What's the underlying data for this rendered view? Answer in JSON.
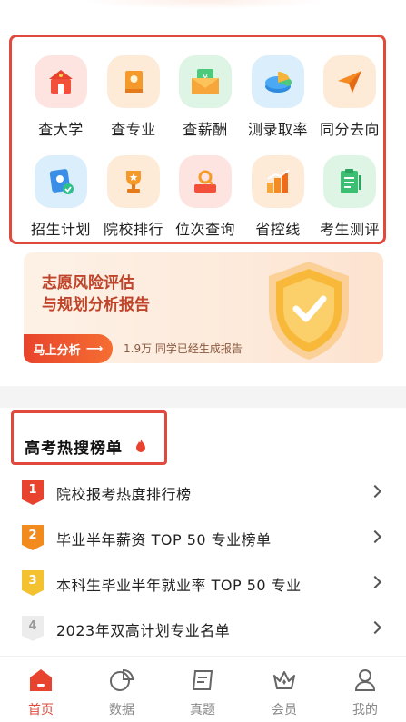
{
  "quick_grid": [
    {
      "label": "查大学",
      "icon": "university-icon"
    },
    {
      "label": "查专业",
      "icon": "book-icon"
    },
    {
      "label": "查薪酬",
      "icon": "salary-envelope-icon"
    },
    {
      "label": "测录取率",
      "icon": "pie-chart-icon"
    },
    {
      "label": "同分去向",
      "icon": "paper-plane-icon"
    },
    {
      "label": "招生计划",
      "icon": "enroll-plan-icon"
    },
    {
      "label": "院校排行",
      "icon": "trophy-icon"
    },
    {
      "label": "位次查询",
      "icon": "rank-search-icon"
    },
    {
      "label": "省控线",
      "icon": "bar-growth-icon"
    },
    {
      "label": "考生测评",
      "icon": "clipboard-icon"
    }
  ],
  "banner": {
    "title": "志愿风险评估\n与规划分析报告",
    "button": "马上分析",
    "note": "1.9万 同学已经生成报告"
  },
  "hot_list": {
    "title": "高考热搜榜单",
    "items": [
      {
        "rank": "1",
        "text": "院校报考热度排行榜",
        "color": "#e8432f"
      },
      {
        "rank": "2",
        "text": "毕业半年薪资 TOP 50 专业榜单",
        "color": "#f28a1e"
      },
      {
        "rank": "3",
        "text": "本科生毕业半年就业率 TOP 50 专业",
        "color": "#f4c230"
      },
      {
        "rank": "4",
        "text": "2023年双高计划专业名单",
        "color": "#dcdcdc"
      }
    ]
  },
  "tabbar": [
    {
      "label": "首页",
      "icon": "home-icon",
      "active": true
    },
    {
      "label": "数据",
      "icon": "data-chart-icon",
      "active": false
    },
    {
      "label": "真题",
      "icon": "exam-paper-icon",
      "active": false
    },
    {
      "label": "会员",
      "icon": "crown-icon",
      "active": false
    },
    {
      "label": "我的",
      "icon": "user-icon",
      "active": false
    }
  ],
  "colors": {
    "accent": "#e0493c",
    "highlight_border": "#e0493c"
  }
}
